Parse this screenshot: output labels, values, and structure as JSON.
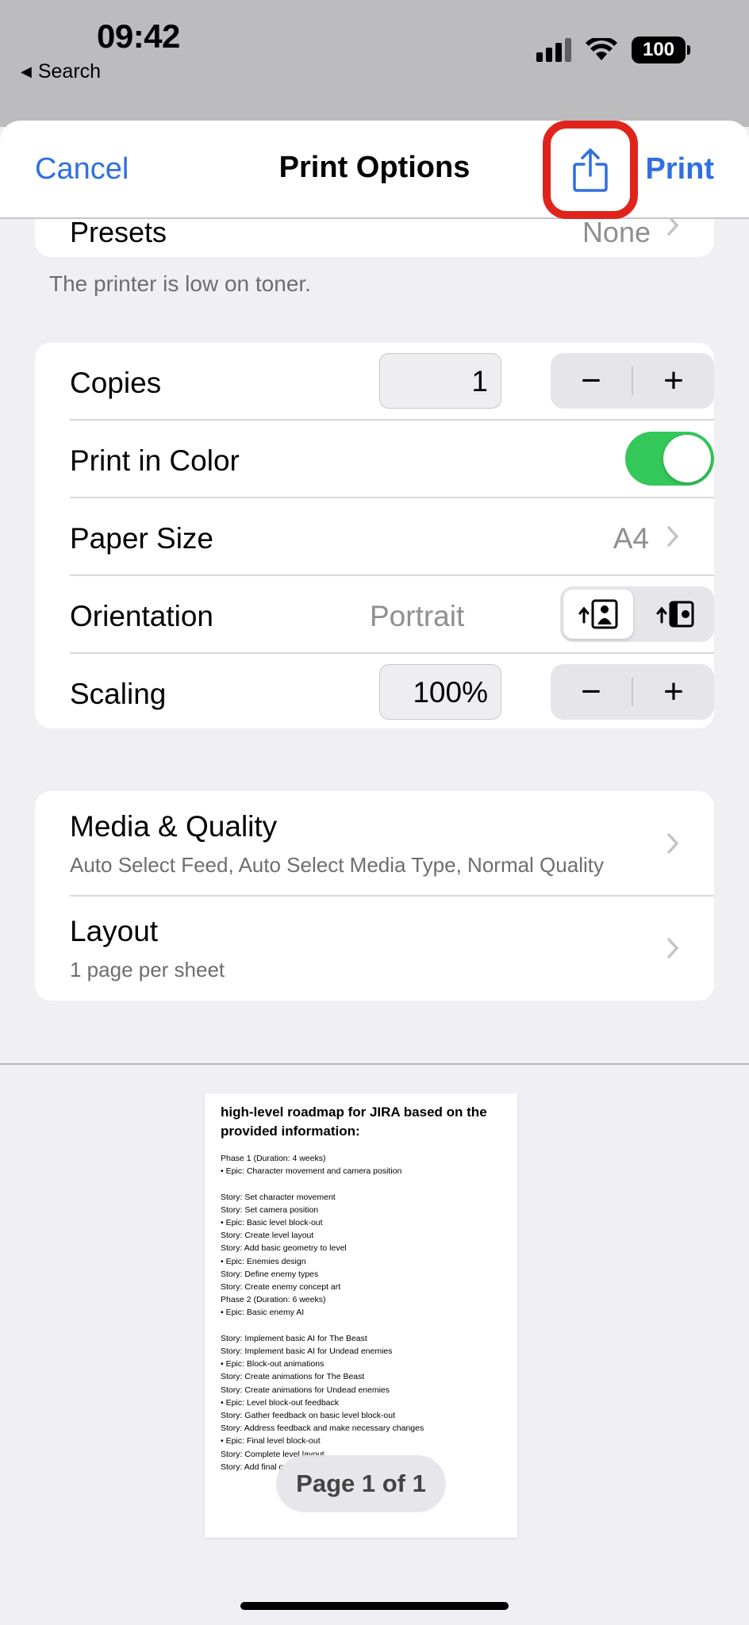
{
  "status_bar": {
    "time": "09:42",
    "back_label": "Search",
    "battery": "100"
  },
  "nav": {
    "cancel": "Cancel",
    "title": "Print Options",
    "print": "Print"
  },
  "presets": {
    "label": "Presets",
    "value": "None"
  },
  "toner_note": "The printer is low on toner.",
  "copies": {
    "label": "Copies",
    "value": "1"
  },
  "color": {
    "label": "Print in Color",
    "on": true
  },
  "paper_size": {
    "label": "Paper Size",
    "value": "A4"
  },
  "orientation": {
    "label": "Orientation",
    "value": "Portrait"
  },
  "scaling": {
    "label": "Scaling",
    "value": "100%"
  },
  "media_quality": {
    "title": "Media & Quality",
    "subtitle": "Auto Select Feed, Auto Select Media Type, Normal Quality"
  },
  "layout": {
    "title": "Layout",
    "subtitle": "1 page per sheet"
  },
  "preview": {
    "heading": "high-level roadmap for JIRA based on the provided information:",
    "lines": [
      "Phase 1 (Duration: 4 weeks)",
      "• Epic: Character movement and camera position",
      "",
      "Story: Set character movement",
      "Story: Set camera position",
      "• Epic: Basic level block-out",
      "Story: Create level layout",
      "Story: Add basic geometry to level",
      "• Epic: Enemies design",
      "Story: Define enemy types",
      "Story: Create enemy concept art",
      "Phase 2 (Duration: 6 weeks)",
      "• Epic: Basic enemy AI",
      "",
      "Story: Implement basic AI for The Beast",
      "Story: Implement basic AI for Undead enemies",
      "• Epic: Block-out animations",
      "Story: Create animations for The Beast",
      "Story: Create animations for Undead enemies",
      "• Epic: Level block-out feedback",
      "Story: Gather feedback on basic level block-out",
      "Story: Address feedback and make necessary changes",
      "• Epic: Final level block-out",
      "Story: Complete level layout",
      "Story: Add final g"
    ],
    "page_indicator": "Page 1 of 1"
  },
  "colors": {
    "accent": "#2f6fe0",
    "toggle_on": "#34c759",
    "highlight": "#e0241b"
  }
}
